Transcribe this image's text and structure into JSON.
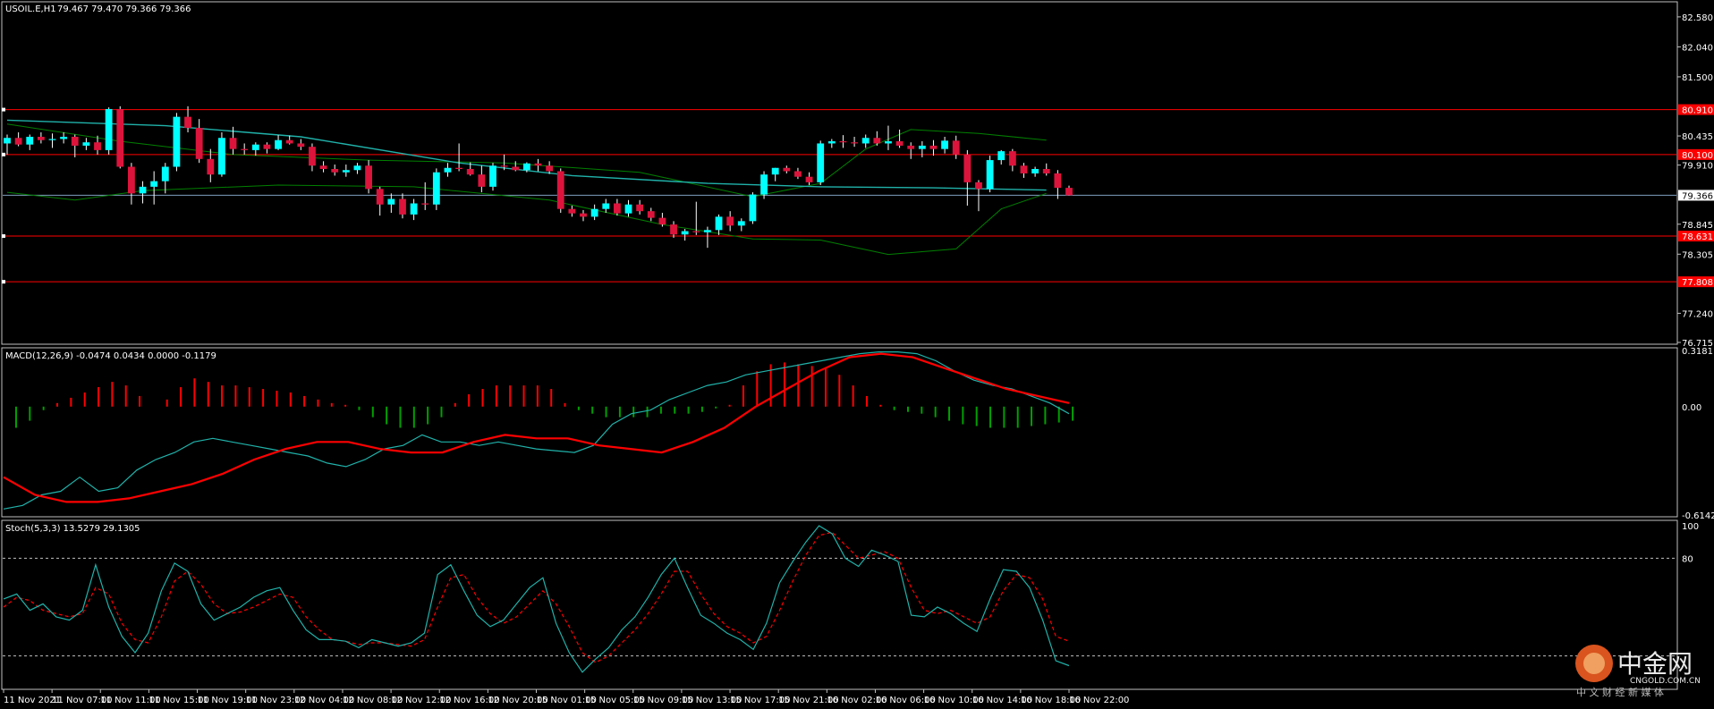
{
  "main_header": {
    "symbol": "USOIL.E,H1",
    "ohlc": "79.467 79.470 79.366 79.366"
  },
  "macd_header": {
    "label": "MACD(12,26,9) -0.0474 0.0434 0.0000 -0.1179"
  },
  "stoch_header": {
    "label": "Stoch(5,3,3) 13.5279 29.1305"
  },
  "price_axis": [
    "82.580",
    "82.040",
    "81.500",
    "80.435",
    "79.910",
    "78.845",
    "78.305",
    "77.240",
    "76.715"
  ],
  "current_price": "79.366",
  "level_tags": [
    "80.910",
    "80.100",
    "78.631",
    "77.808"
  ],
  "macd_axis": [
    "0.3181",
    "0.00",
    "-0.6142"
  ],
  "stoch_axis": [
    "100",
    "80"
  ],
  "time_labels": [
    "11 Nov 2021",
    "11 Nov 07:00",
    "11 Nov 11:00",
    "11 Nov 15:00",
    "11 Nov 19:00",
    "11 Nov 23:00",
    "12 Nov 04:00",
    "12 Nov 08:00",
    "12 Nov 12:00",
    "12 Nov 16:00",
    "12 Nov 20:00",
    "15 Nov 01:00",
    "15 Nov 05:00",
    "15 Nov 09:00",
    "15 Nov 13:00",
    "15 Nov 17:00",
    "15 Nov 21:00",
    "16 Nov 02:00",
    "16 Nov 06:00",
    "16 Nov 10:00",
    "16 Nov 14:00",
    "16 Nov 18:00",
    "16 Nov 22:00"
  ],
  "watermark": {
    "brand": "中金网",
    "site": "CNGOLD.COM.CN",
    "tagline": "中 文 财 经 新 媒 体"
  },
  "colors": {
    "bull": "#00ffff",
    "bear": "#dc143c",
    "ma": "#20b2aa",
    "bands": "#008000",
    "levels": "#ff0000",
    "grid": "#c0c0c0",
    "macd_signal": "#ff0000",
    "macd_line": "#20b2aa",
    "stoch_main": "#20b2aa",
    "stoch_signal": "#ff0000"
  },
  "chart_data": [
    {
      "type": "candlestick",
      "title": "USOIL.E,H1",
      "x": [
        "11 Nov 2021",
        "11 Nov 07:00",
        "11 Nov 11:00",
        "11 Nov 15:00",
        "11 Nov 19:00",
        "11 Nov 23:00",
        "12 Nov 04:00",
        "12 Nov 08:00",
        "12 Nov 12:00",
        "12 Nov 16:00",
        "12 Nov 20:00",
        "15 Nov 01:00",
        "15 Nov 05:00",
        "15 Nov 09:00",
        "15 Nov 13:00",
        "15 Nov 17:00",
        "15 Nov 21:00",
        "16 Nov 02:00",
        "16 Nov 06:00",
        "16 Nov 10:00",
        "16 Nov 14:00",
        "16 Nov 18:00",
        "16 Nov 22:00"
      ],
      "ylim": [
        76.715,
        82.82
      ],
      "candles": [
        [
          80.3,
          80.46,
          80.1,
          80.4
        ],
        [
          80.4,
          80.5,
          80.25,
          80.28
        ],
        [
          80.28,
          80.46,
          80.18,
          80.42
        ],
        [
          80.42,
          80.5,
          80.3,
          80.36
        ],
        [
          80.36,
          80.48,
          80.22,
          80.38
        ],
        [
          80.38,
          80.5,
          80.3,
          80.42
        ],
        [
          80.42,
          80.46,
          80.05,
          80.26
        ],
        [
          80.26,
          80.4,
          80.18,
          80.32
        ],
        [
          80.32,
          80.44,
          80.1,
          80.18
        ],
        [
          80.18,
          80.95,
          80.1,
          80.92
        ],
        [
          80.92,
          80.97,
          79.85,
          79.88
        ],
        [
          79.88,
          79.95,
          79.2,
          79.4
        ],
        [
          79.4,
          79.62,
          79.22,
          79.52
        ],
        [
          79.52,
          79.8,
          79.2,
          79.62
        ],
        [
          79.62,
          79.95,
          79.4,
          79.88
        ],
        [
          79.88,
          80.85,
          79.8,
          80.78
        ],
        [
          80.78,
          80.97,
          80.5,
          80.58
        ],
        [
          80.58,
          80.74,
          79.95,
          80.02
        ],
        [
          80.02,
          80.2,
          79.6,
          79.74
        ],
        [
          79.74,
          80.5,
          79.7,
          80.4
        ],
        [
          80.4,
          80.6,
          80.1,
          80.2
        ],
        [
          80.2,
          80.3,
          80.1,
          80.18
        ],
        [
          80.18,
          80.32,
          80.08,
          80.28
        ],
        [
          80.28,
          80.32,
          80.12,
          80.2
        ],
        [
          80.2,
          80.45,
          80.18,
          80.36
        ],
        [
          80.36,
          80.44,
          80.28,
          80.3
        ],
        [
          80.3,
          80.38,
          80.18,
          80.24
        ],
        [
          80.24,
          80.3,
          79.8,
          79.9
        ],
        [
          79.9,
          79.98,
          79.78,
          79.84
        ],
        [
          79.84,
          79.92,
          79.72,
          79.78
        ],
        [
          79.78,
          79.92,
          79.7,
          79.82
        ],
        [
          79.82,
          79.95,
          79.75,
          79.9
        ],
        [
          79.9,
          80.0,
          79.4,
          79.48
        ],
        [
          79.48,
          79.52,
          79.0,
          79.2
        ],
        [
          79.2,
          79.4,
          79.05,
          79.3
        ],
        [
          79.3,
          79.4,
          78.95,
          79.02
        ],
        [
          79.02,
          79.3,
          78.92,
          79.22
        ],
        [
          79.22,
          79.6,
          79.1,
          79.2
        ],
        [
          79.2,
          79.85,
          79.1,
          79.78
        ],
        [
          79.78,
          79.95,
          79.7,
          79.86
        ],
        [
          79.86,
          80.3,
          79.8,
          79.84
        ],
        [
          79.84,
          79.96,
          79.72,
          79.74
        ],
        [
          79.74,
          79.9,
          79.42,
          79.52
        ],
        [
          79.52,
          79.95,
          79.45,
          79.9
        ],
        [
          79.9,
          80.1,
          79.82,
          79.88
        ],
        [
          79.88,
          79.98,
          79.8,
          79.82
        ],
        [
          79.82,
          79.96,
          79.78,
          79.94
        ],
        [
          79.94,
          80.02,
          79.8,
          79.9
        ],
        [
          79.9,
          79.98,
          79.75,
          79.8
        ],
        [
          79.8,
          79.85,
          79.05,
          79.12
        ],
        [
          79.12,
          79.18,
          78.98,
          79.04
        ],
        [
          79.04,
          79.1,
          78.9,
          78.98
        ],
        [
          78.98,
          79.2,
          78.92,
          79.12
        ],
        [
          79.12,
          79.3,
          79.05,
          79.22
        ],
        [
          79.22,
          79.3,
          79.0,
          79.04
        ],
        [
          79.04,
          79.28,
          78.98,
          79.2
        ],
        [
          79.2,
          79.28,
          79.02,
          79.08
        ],
        [
          79.08,
          79.14,
          78.9,
          78.96
        ],
        [
          78.96,
          79.05,
          78.8,
          78.84
        ],
        [
          78.84,
          78.9,
          78.6,
          78.66
        ],
        [
          78.66,
          78.76,
          78.55,
          78.72
        ],
        [
          78.72,
          79.25,
          78.65,
          78.7
        ],
        [
          78.7,
          78.8,
          78.42,
          78.74
        ],
        [
          78.74,
          79.02,
          78.65,
          78.98
        ],
        [
          78.98,
          79.08,
          78.72,
          78.82
        ],
        [
          78.82,
          78.95,
          78.72,
          78.9
        ],
        [
          78.9,
          79.42,
          78.85,
          79.38
        ],
        [
          79.38,
          79.8,
          79.3,
          79.74
        ],
        [
          79.74,
          79.86,
          79.62,
          79.86
        ],
        [
          79.86,
          79.9,
          79.76,
          79.8
        ],
        [
          79.8,
          79.86,
          79.66,
          79.7
        ],
        [
          79.7,
          79.78,
          79.55,
          79.6
        ],
        [
          79.6,
          80.35,
          79.55,
          80.3
        ],
        [
          80.3,
          80.38,
          80.22,
          80.34
        ],
        [
          80.34,
          80.45,
          80.22,
          80.32
        ],
        [
          80.32,
          80.42,
          80.24,
          80.3
        ],
        [
          80.3,
          80.46,
          80.22,
          80.4
        ],
        [
          80.4,
          80.52,
          80.26,
          80.3
        ],
        [
          80.3,
          80.62,
          80.18,
          80.34
        ],
        [
          80.34,
          80.55,
          80.22,
          80.26
        ],
        [
          80.26,
          80.32,
          80.02,
          80.2
        ],
        [
          80.2,
          80.34,
          80.05,
          80.26
        ],
        [
          80.26,
          80.36,
          80.08,
          80.2
        ],
        [
          80.2,
          80.42,
          80.12,
          80.35
        ],
        [
          80.35,
          80.44,
          80.02,
          80.1
        ],
        [
          80.1,
          80.18,
          79.18,
          79.6
        ],
        [
          79.6,
          79.64,
          79.08,
          79.48
        ],
        [
          79.48,
          80.08,
          79.42,
          80.0
        ],
        [
          80.0,
          80.18,
          79.92,
          80.16
        ],
        [
          80.16,
          80.2,
          79.8,
          79.9
        ],
        [
          79.9,
          79.95,
          79.68,
          79.76
        ],
        [
          79.76,
          79.88,
          79.7,
          79.84
        ],
        [
          79.84,
          79.94,
          79.72,
          79.76
        ],
        [
          79.76,
          79.82,
          79.3,
          79.5
        ],
        [
          79.5,
          79.54,
          79.36,
          79.366
        ]
      ],
      "ma": [
        [
          0,
          80.72
        ],
        [
          14,
          80.62
        ],
        [
          26,
          80.42
        ],
        [
          40,
          79.95
        ],
        [
          50,
          79.72
        ],
        [
          62,
          79.58
        ],
        [
          72,
          79.52
        ],
        [
          82,
          79.5
        ],
        [
          92,
          79.46
        ]
      ],
      "bb_upper": [
        [
          0,
          80.65
        ],
        [
          10,
          80.34
        ],
        [
          20,
          80.1
        ],
        [
          32,
          80.0
        ],
        [
          44,
          79.95
        ],
        [
          56,
          79.78
        ],
        [
          66,
          79.34
        ],
        [
          72,
          79.58
        ],
        [
          76,
          80.2
        ],
        [
          80,
          80.55
        ],
        [
          86,
          80.48
        ],
        [
          92,
          80.36
        ]
      ],
      "bb_lower": [
        [
          0,
          79.42
        ],
        [
          6,
          79.28
        ],
        [
          12,
          79.45
        ],
        [
          24,
          79.55
        ],
        [
          36,
          79.52
        ],
        [
          48,
          79.28
        ],
        [
          58,
          78.84
        ],
        [
          66,
          78.58
        ],
        [
          72,
          78.56
        ],
        [
          78,
          78.3
        ],
        [
          84,
          78.4
        ],
        [
          88,
          79.12
        ],
        [
          92,
          79.4
        ]
      ],
      "levels": [
        80.91,
        80.1,
        78.631,
        77.808
      ]
    },
    {
      "type": "bar",
      "title": "MACD(12,26,9) -0.0474 0.0434 0.0000 -0.1179",
      "ylim": [
        -0.6142,
        0.3181
      ],
      "histogram": [
        -0.12,
        -0.08,
        -0.02,
        0.02,
        0.05,
        0.08,
        0.11,
        0.14,
        0.12,
        0.06,
        0.0,
        0.04,
        0.11,
        0.16,
        0.14,
        0.12,
        0.12,
        0.11,
        0.1,
        0.09,
        0.08,
        0.06,
        0.04,
        0.02,
        0.01,
        -0.02,
        -0.06,
        -0.1,
        -0.12,
        -0.12,
        -0.1,
        -0.06,
        0.02,
        0.07,
        0.1,
        0.12,
        0.12,
        0.12,
        0.12,
        0.1,
        0.02,
        -0.02,
        -0.04,
        -0.06,
        -0.06,
        -0.06,
        -0.06,
        -0.04,
        -0.04,
        -0.04,
        -0.03,
        -0.01,
        0.01,
        0.12,
        0.2,
        0.24,
        0.25,
        0.24,
        0.23,
        0.22,
        0.18,
        0.12,
        0.06,
        0.01,
        -0.02,
        -0.03,
        -0.04,
        -0.06,
        -0.08,
        -0.1,
        -0.11,
        -0.12,
        -0.12,
        -0.12,
        -0.11,
        -0.1,
        -0.09,
        -0.08
      ],
      "macd_line": [
        -0.58,
        -0.56,
        -0.5,
        -0.48,
        -0.4,
        -0.48,
        -0.46,
        -0.36,
        -0.3,
        -0.26,
        -0.2,
        -0.18,
        -0.2,
        -0.22,
        -0.24,
        -0.26,
        -0.28,
        -0.32,
        -0.34,
        -0.3,
        -0.24,
        -0.22,
        -0.16,
        -0.2,
        -0.2,
        -0.22,
        -0.2,
        -0.22,
        -0.24,
        -0.25,
        -0.26,
        -0.22,
        -0.1,
        -0.04,
        -0.02,
        0.04,
        0.08,
        0.12,
        0.14,
        0.18,
        0.2,
        0.22,
        0.24,
        0.26,
        0.28,
        0.3,
        0.31,
        0.31,
        0.3,
        0.26,
        0.2,
        0.15,
        0.12,
        0.1,
        0.06,
        0.02,
        -0.04
      ],
      "signal_line": [
        -0.4,
        -0.5,
        -0.54,
        -0.54,
        -0.52,
        -0.48,
        -0.44,
        -0.38,
        -0.3,
        -0.24,
        -0.2,
        -0.2,
        -0.24,
        -0.26,
        -0.26,
        -0.2,
        -0.16,
        -0.18,
        -0.18,
        -0.22,
        -0.24,
        -0.26,
        -0.2,
        -0.12,
        0.0,
        0.1,
        0.2,
        0.28,
        0.3,
        0.28,
        0.22,
        0.16,
        0.1,
        0.06,
        0.02
      ]
    },
    {
      "type": "line",
      "title": "Stoch(5,3,3) 13.5279 29.1305",
      "ylim": [
        0,
        100
      ],
      "levels": [
        20,
        80
      ],
      "k_line": [
        55,
        58,
        48,
        52,
        44,
        42,
        48,
        76,
        50,
        32,
        22,
        34,
        60,
        77,
        72,
        52,
        42,
        46,
        50,
        56,
        60,
        62,
        48,
        36,
        30,
        30,
        29,
        25,
        30,
        28,
        26,
        28,
        34,
        70,
        76,
        60,
        45,
        38,
        42,
        52,
        62,
        68,
        40,
        22,
        10,
        18,
        25,
        36,
        44,
        56,
        70,
        80,
        62,
        45,
        40,
        34,
        30,
        24,
        40,
        65,
        78,
        90,
        100,
        95,
        80,
        75,
        85,
        82,
        78,
        45,
        44,
        50,
        46,
        40,
        35,
        55,
        73,
        72,
        62,
        42,
        17,
        14
      ],
      "d_line": [
        50,
        56,
        54,
        48,
        46,
        44,
        46,
        62,
        58,
        40,
        30,
        28,
        44,
        66,
        72,
        64,
        52,
        46,
        47,
        50,
        54,
        58,
        56,
        44,
        36,
        30,
        29,
        27,
        28,
        28,
        27,
        26,
        30,
        50,
        68,
        70,
        56,
        46,
        40,
        44,
        52,
        60,
        52,
        38,
        22,
        16,
        20,
        28,
        36,
        46,
        58,
        72,
        72,
        58,
        46,
        38,
        34,
        28,
        32,
        48,
        66,
        82,
        94,
        96,
        88,
        80,
        82,
        84,
        80,
        62,
        48,
        46,
        48,
        44,
        40,
        44,
        60,
        70,
        68,
        55,
        32,
        29
      ]
    }
  ]
}
